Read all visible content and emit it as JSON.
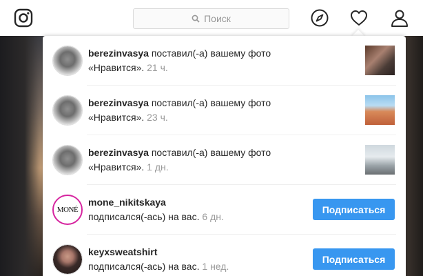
{
  "search": {
    "placeholder": "Поиск"
  },
  "notifications": [
    {
      "username": "berezinvasya",
      "action": "поставил(-а) вашему фото",
      "quote": "«Нравится».",
      "time": "21 ч."
    },
    {
      "username": "berezinvasya",
      "action": "поставил(-а) вашему фото",
      "quote": "«Нравится».",
      "time": "23 ч."
    },
    {
      "username": "berezinvasya",
      "action": "поставил(-а) вашему фото",
      "quote": "«Нравится».",
      "time": "1 дн."
    },
    {
      "username": "mone_nikitskaya",
      "action": "подписался(-ась) на вас.",
      "time": "6 дн.",
      "button": "Подписаться",
      "avatar_text": "MONÉ"
    },
    {
      "username": "keyxsweatshirt",
      "action": "подписался(-ась) на вас.",
      "time": "1 нед.",
      "button": "Подписаться"
    }
  ],
  "colors": {
    "accent": "#3897f0",
    "text": "#262626",
    "muted": "#999999",
    "border": "#dbdbdb"
  },
  "icons": [
    "instagram-logo-icon",
    "search-icon",
    "explore-compass-icon",
    "heart-icon",
    "profile-icon"
  ]
}
